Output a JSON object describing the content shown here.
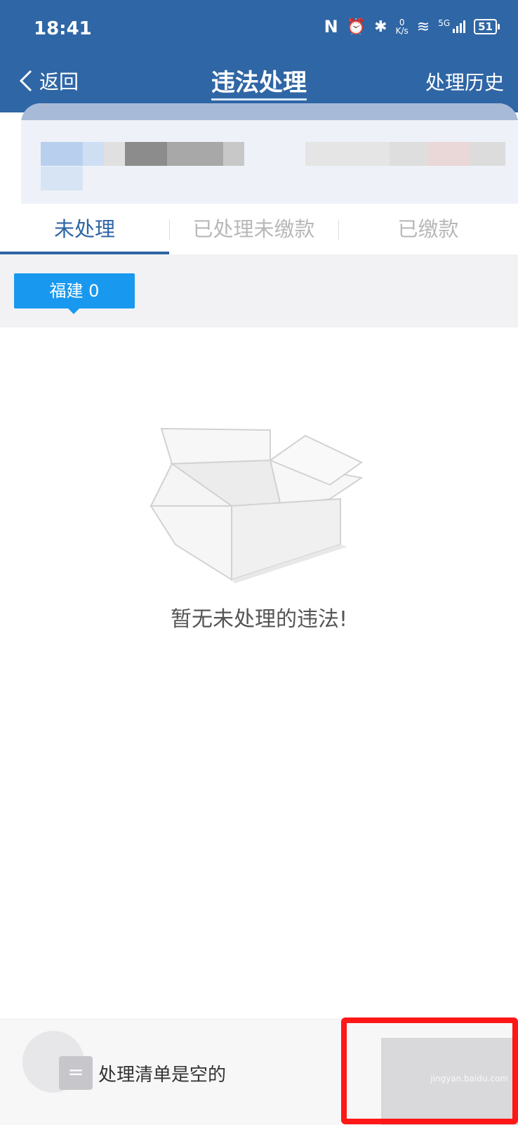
{
  "status_bar": {
    "time": "18:41",
    "speed": "0\nK/s",
    "network": "5G",
    "battery": "51"
  },
  "nav": {
    "back_label": "返回",
    "title": "违法处理",
    "history_label": "处理历史"
  },
  "tabs": [
    {
      "label": "未处理",
      "active": true
    },
    {
      "label": "已处理未缴款",
      "active": false
    },
    {
      "label": "已缴款",
      "active": false
    }
  ],
  "filter": {
    "province_chip": "福建 0"
  },
  "empty_state": {
    "message": "暂无未处理的违法!"
  },
  "bottom_bar": {
    "cart_icon": "=",
    "status": "处理清单是空的",
    "watermark": "jingyan.baidu.com"
  },
  "colors": {
    "header": "#2f66a5",
    "accent": "#1899ef",
    "highlight": "#ff1616"
  }
}
